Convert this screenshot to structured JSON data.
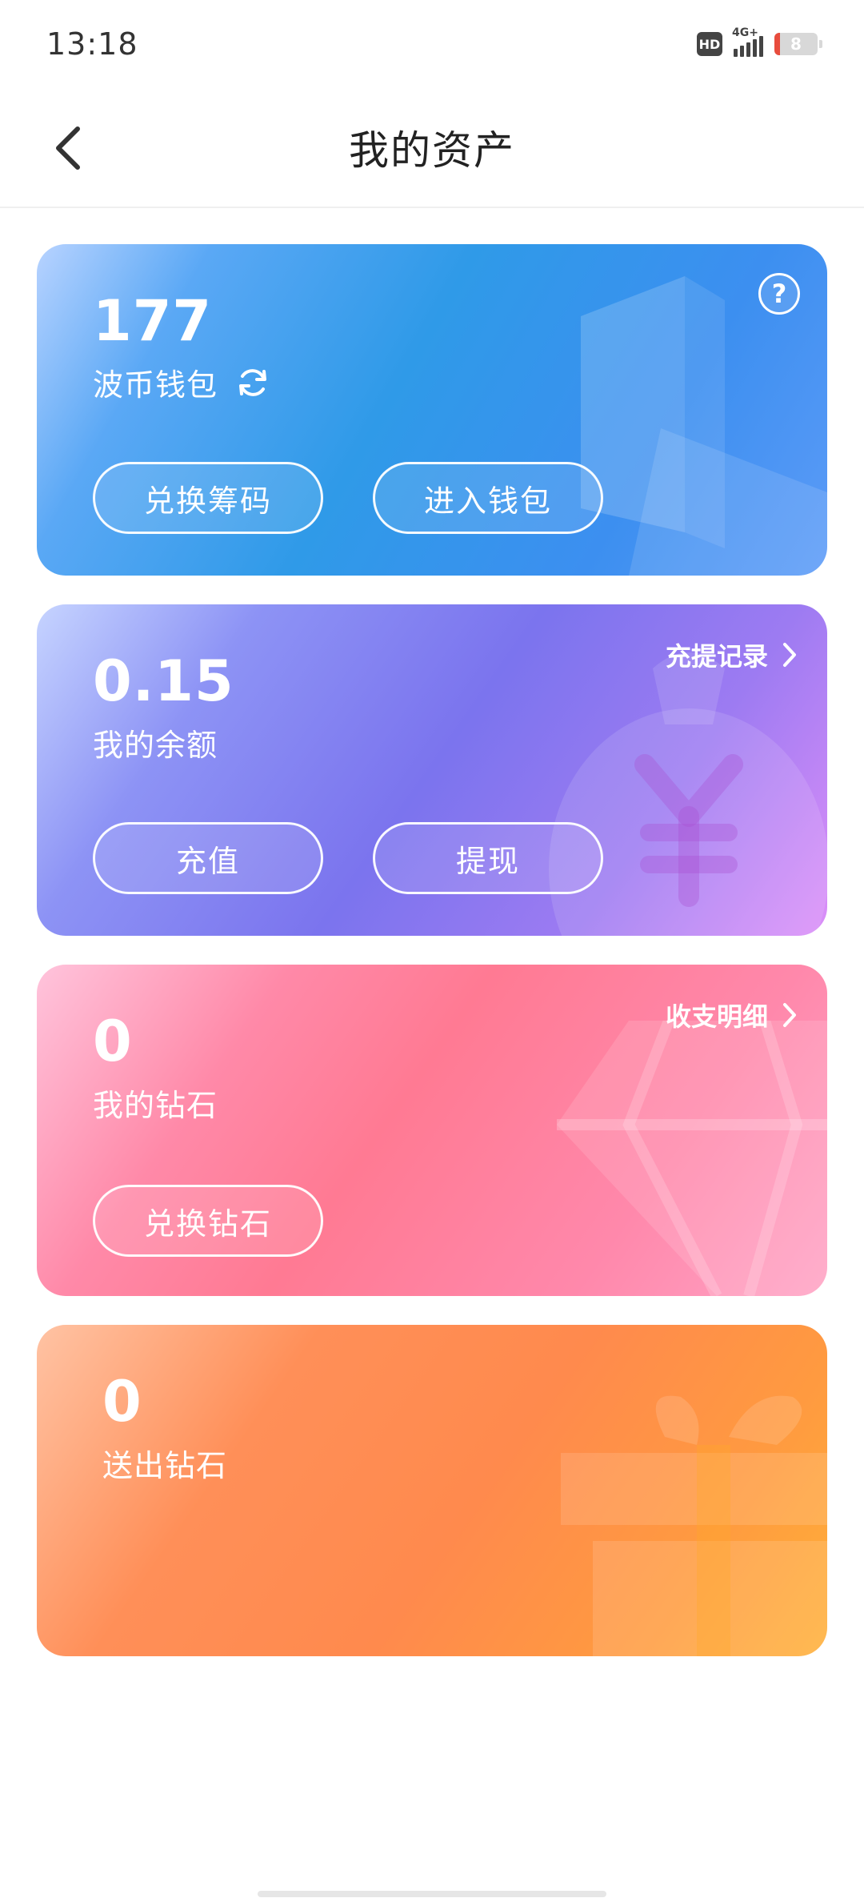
{
  "status_bar": {
    "time": "13:18",
    "hd": "HD",
    "network": "4G+",
    "battery": "8"
  },
  "header": {
    "title": "我的资产",
    "back_icon": "chevron-left-icon"
  },
  "wallet_card": {
    "amount": "177",
    "label": "波币钱包",
    "refresh_icon": "refresh-icon",
    "help": "?",
    "buttons": [
      "兑换筹码",
      "进入钱包"
    ]
  },
  "balance_card": {
    "amount": "0.15",
    "label": "我的余额",
    "link": "充提记录",
    "buttons": [
      "充值",
      "提现"
    ]
  },
  "diamond_card": {
    "amount": "0",
    "label": "我的钻石",
    "link": "收支明细",
    "buttons": [
      "兑换钻石"
    ]
  },
  "sent_card": {
    "amount": "0",
    "label": "送出钻石"
  },
  "colors": {
    "wallet": "#3c8ff0",
    "balance": "#7b74ee",
    "diamond": "#ff7a93",
    "sent": "#ff8a4d"
  }
}
